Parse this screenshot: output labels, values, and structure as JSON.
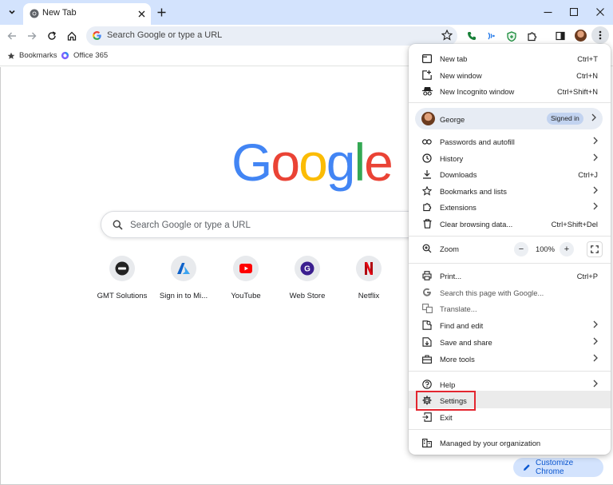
{
  "tabstrip": {
    "tab_title": "New Tab",
    "colors": {
      "strip": "#d3e3fd",
      "tab": "#ffffff"
    },
    "icons": [
      "tab-search-icon",
      "chrome-favicon-icon",
      "close-icon",
      "plus-icon",
      "minimize-icon",
      "maximize-icon",
      "window-close-icon"
    ]
  },
  "toolbar": {
    "omnibox_placeholder": "Search Google or type a URL",
    "icons": [
      "back-icon",
      "forward-icon",
      "reload-icon",
      "home-icon",
      "star-icon",
      "phone-icon",
      "wifi-icon",
      "shield-icon",
      "extensions-icon",
      "side-panel-icon",
      "avatar",
      "kebab-menu-icon"
    ]
  },
  "bookmarks": {
    "items": [
      {
        "label": "Bookmarks",
        "icon": "star-icon"
      },
      {
        "label": "Office 365",
        "icon": "office-icon"
      }
    ]
  },
  "ntp": {
    "logo_letters": [
      {
        "ch": "G",
        "color": "#4285F4"
      },
      {
        "ch": "o",
        "color": "#EA4335"
      },
      {
        "ch": "o",
        "color": "#FBBC05"
      },
      {
        "ch": "g",
        "color": "#4285F4"
      },
      {
        "ch": "l",
        "color": "#34A853"
      },
      {
        "ch": "e",
        "color": "#EA4335"
      }
    ],
    "search_placeholder": "Search Google or type a URL",
    "shortcuts": [
      {
        "label": "GMT Solutions"
      },
      {
        "label": "Sign in to Mi..."
      },
      {
        "label": "YouTube"
      },
      {
        "label": "Web Store"
      },
      {
        "label": "Netflix"
      }
    ],
    "customize_label": "Customize Chrome"
  },
  "menu": {
    "group1": [
      {
        "label": "New tab",
        "shortcut": "Ctrl+T",
        "icon": "new-tab-icon"
      },
      {
        "label": "New window",
        "shortcut": "Ctrl+N",
        "icon": "new-window-icon"
      },
      {
        "label": "New Incognito window",
        "shortcut": "Ctrl+Shift+N",
        "icon": "incognito-icon"
      }
    ],
    "profile": {
      "name": "George",
      "badge": "Signed in"
    },
    "group2": [
      {
        "label": "Passwords and autofill",
        "icon": "key-icon",
        "submenu": true
      },
      {
        "label": "History",
        "icon": "history-icon",
        "submenu": true
      },
      {
        "label": "Downloads",
        "shortcut": "Ctrl+J",
        "icon": "download-icon"
      },
      {
        "label": "Bookmarks and lists",
        "icon": "star-icon",
        "submenu": true
      },
      {
        "label": "Extensions",
        "icon": "extensions-icon",
        "submenu": true
      },
      {
        "label": "Clear browsing data...",
        "shortcut": "Ctrl+Shift+Del",
        "icon": "trash-icon"
      }
    ],
    "zoom": {
      "label": "Zoom",
      "minus": "−",
      "value": "100%",
      "plus": "+"
    },
    "group3": [
      {
        "label": "Print...",
        "shortcut": "Ctrl+P",
        "icon": "print-icon"
      },
      {
        "label": "Search this page with Google...",
        "icon": "google-icon",
        "disabled": true
      },
      {
        "label": "Translate...",
        "icon": "translate-icon",
        "disabled": true
      },
      {
        "label": "Find and edit",
        "icon": "find-icon",
        "submenu": true
      },
      {
        "label": "Save and share",
        "icon": "save-share-icon",
        "submenu": true
      },
      {
        "label": "More tools",
        "icon": "toolbox-icon",
        "submenu": true
      }
    ],
    "group4": [
      {
        "label": "Help",
        "icon": "help-icon",
        "submenu": true
      },
      {
        "label": "Settings",
        "icon": "gear-icon"
      },
      {
        "label": "Exit",
        "icon": "exit-icon"
      }
    ],
    "managed": {
      "label": "Managed by your organization",
      "icon": "building-icon"
    },
    "highlight_color": "#e3262f"
  }
}
